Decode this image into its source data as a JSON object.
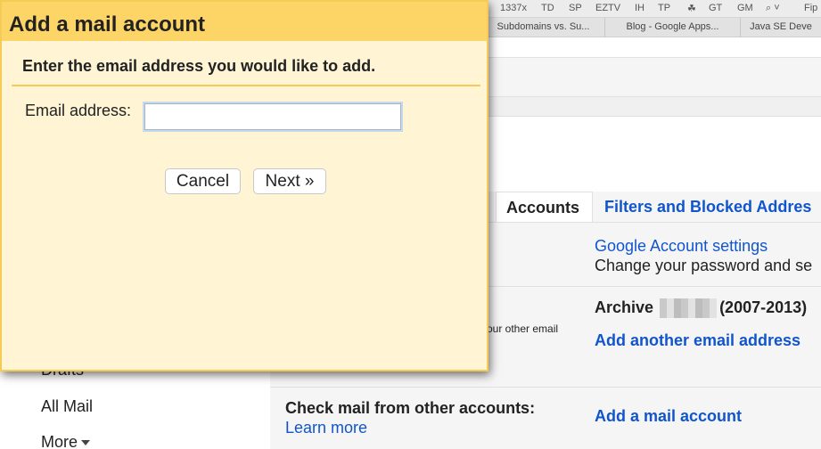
{
  "browser": {
    "bookmarks": [
      "1337x",
      "TD",
      "SP",
      "EZTV",
      "IH",
      "TP",
      "☘",
      "GT",
      "GM",
      "⌕ ˅",
      "Fip"
    ],
    "tabs": [
      "Subdomains vs. Su...",
      "Blog - Google Apps...",
      "Java SE Deve"
    ]
  },
  "settings": {
    "tabs": {
      "accounts": "Accounts",
      "filters": "Filters and Blocked Addres"
    },
    "google_account_link": "Google Account settings",
    "change_password_text": "Change your password and se",
    "other_email_fragment": "our other email",
    "archive_prefix": "Archive",
    "archive_suffix": "(2007-2013)",
    "add_email_link": "Add another email address",
    "check_mail_label": "Check mail from other accounts:",
    "learn_more_link": "Learn more",
    "add_mail_account_link": "Add a mail account",
    "colon_fragment": ":"
  },
  "left_nav": {
    "drafts": "Drafts",
    "all_mail": "All Mail",
    "more": "More"
  },
  "dialog": {
    "title": "Add a mail account",
    "instruction": "Enter the email address you would like to add.",
    "email_label": "Email address:",
    "email_value": "",
    "email_placeholder": "",
    "cancel_label": "Cancel",
    "next_label": "Next »"
  },
  "colors": {
    "dialog_bg": "#fff4d3",
    "dialog_title_bg": "#fdd466",
    "dialog_border": "#f5cb55",
    "link": "#1155cc"
  }
}
